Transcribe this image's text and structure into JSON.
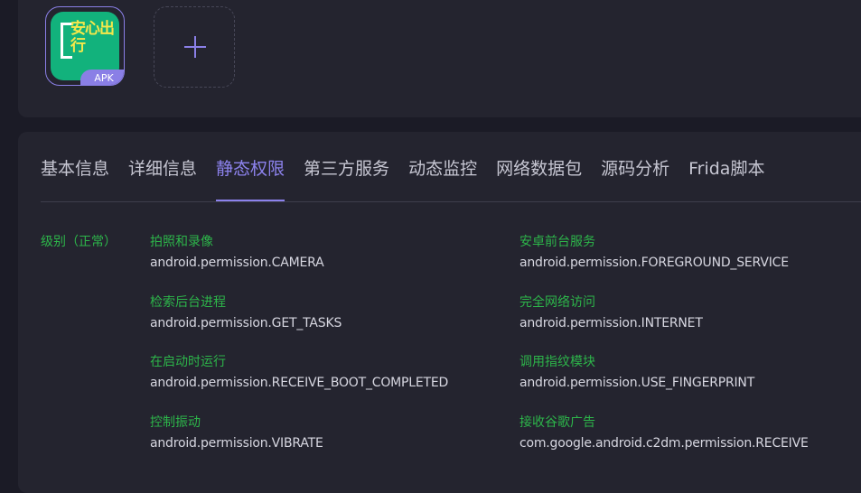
{
  "upload": {
    "apk_badge": "APK",
    "app_icon_text": "安心出行",
    "add_symbol": "+"
  },
  "tabs": [
    {
      "label": "基本信息"
    },
    {
      "label": "详细信息"
    },
    {
      "label": "静态权限"
    },
    {
      "label": "第三方服务"
    },
    {
      "label": "动态监控"
    },
    {
      "label": "网络数据包"
    },
    {
      "label": "源码分析"
    },
    {
      "label": "Frida脚本"
    }
  ],
  "active_tab": "静态权限",
  "permissions": {
    "level_label": "级别（正常）",
    "items": [
      {
        "name": "拍照和录像",
        "id": "android.permission.CAMERA"
      },
      {
        "name": "安卓前台服务",
        "id": "android.permission.FOREGROUND_SERVICE"
      },
      {
        "name": "检索后台进程",
        "id": "android.permission.GET_TASKS"
      },
      {
        "name": "完全网络访问",
        "id": "android.permission.INTERNET"
      },
      {
        "name": "在启动时运行",
        "id": "android.permission.RECEIVE_BOOT_COMPLETED"
      },
      {
        "name": "调用指纹模块",
        "id": "android.permission.USE_FINGERPRINT"
      },
      {
        "name": "控制振动",
        "id": "android.permission.VIBRATE"
      },
      {
        "name": "接收谷歌广告",
        "id": "com.google.android.c2dm.permission.RECEIVE"
      }
    ]
  },
  "colors": {
    "accent": "#8c82ec",
    "permission_name": "#2db54a",
    "background": "#1b1b26",
    "card": "#24242f"
  }
}
